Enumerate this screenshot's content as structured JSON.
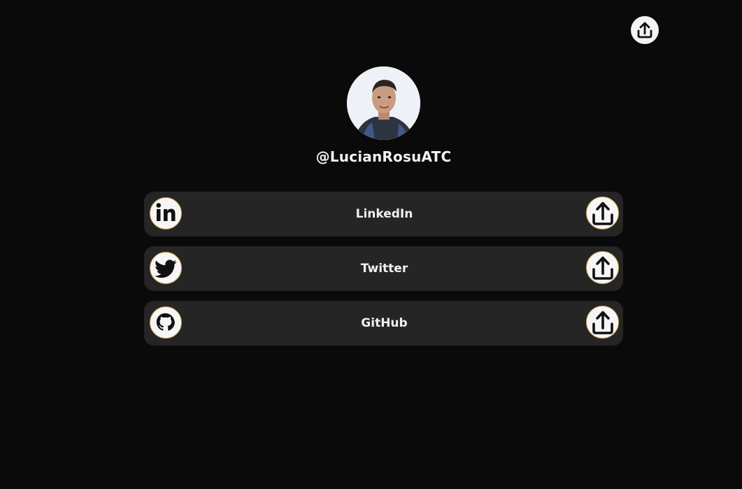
{
  "profile": {
    "handle": "@LucianRosuATC"
  },
  "links": [
    {
      "label": "LinkedIn",
      "icon": "linkedin-icon"
    },
    {
      "label": "Twitter",
      "icon": "twitter-icon"
    },
    {
      "label": "GitHub",
      "icon": "github-icon"
    }
  ],
  "icons": {
    "share": "share-icon"
  },
  "colors": {
    "background": "#0a0a0a",
    "card": "#252525",
    "icon_ring": "#c9a04a",
    "text": "#f0f0f0"
  }
}
